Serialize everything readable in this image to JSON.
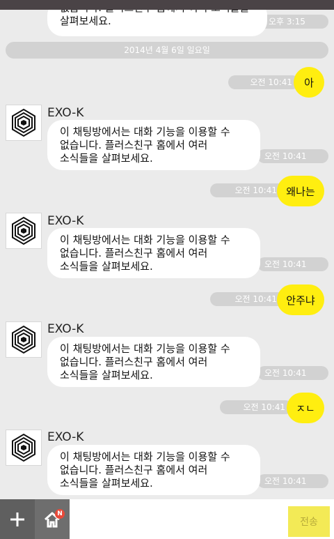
{
  "chat": {
    "top_partial": {
      "line1": "없습니다. 플러스친구 홈에서 여러 소식들을",
      "line2": "살펴보세요.",
      "time": "오후 3:15"
    },
    "date_divider": "2014년 4월 6일 일요일",
    "sender_name": "EXO-K",
    "system_message": {
      "line1": "이 채팅방에서는 대화 기능을 이용할 수",
      "line2": "없습니다. 플러스친구 홈에서 여러",
      "line3": "소식들을 살펴보세요."
    },
    "outgoing": [
      {
        "text": "아",
        "time": "오전 10:41"
      },
      {
        "text": "왜나는",
        "time": "오전 10:41"
      },
      {
        "text": "안주냐",
        "time": "오전 10:41"
      },
      {
        "text": "ㅈㄴ",
        "time": "오전 10:41"
      }
    ],
    "incoming_times": [
      "오전 10:41",
      "오전 10:41",
      "오전 10:41",
      "오전 10:41"
    ]
  },
  "input": {
    "plus_icon": "plus-icon",
    "home_icon": "home-icon",
    "badge": "N",
    "value": "",
    "send_label": "전송"
  },
  "colors": {
    "background": "#ebebeb",
    "outgoing_bubble": "#ffee10",
    "incoming_bubble": "#ffffff",
    "time_pill": "#d2d2d2",
    "send_button": "#f3ea56",
    "badge": "#e84a3a"
  }
}
